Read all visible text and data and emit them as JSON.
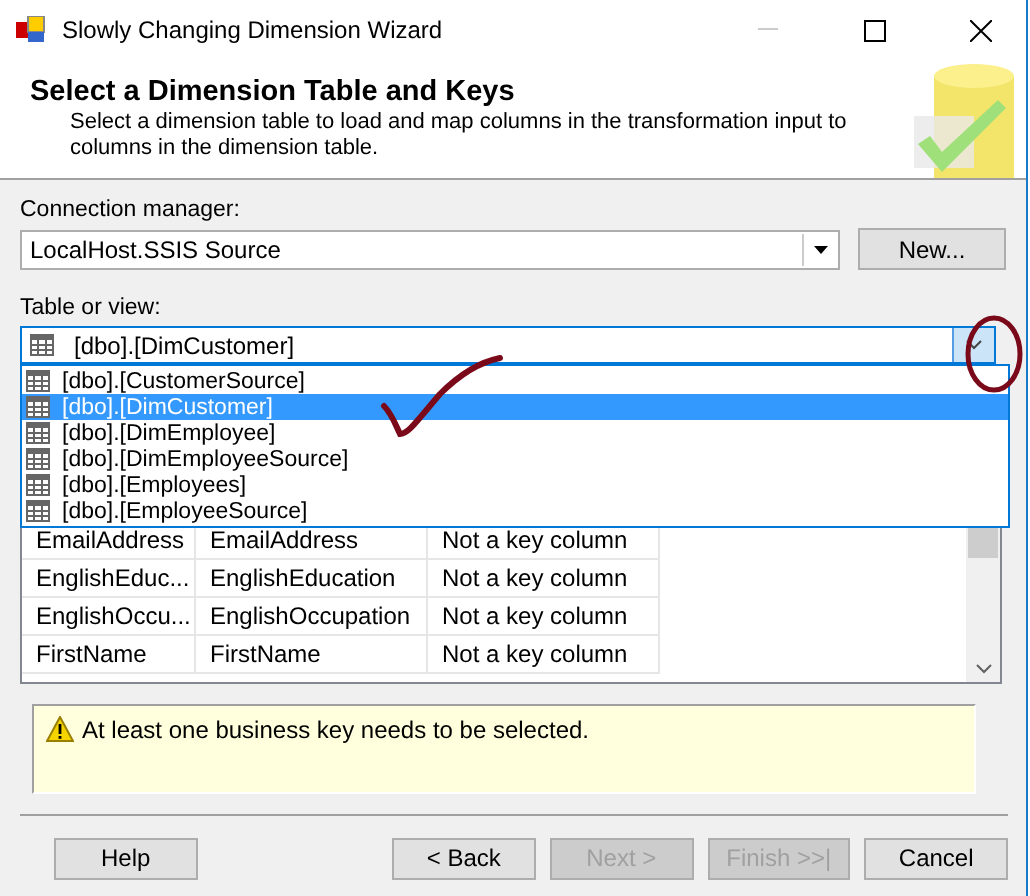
{
  "window": {
    "title": "Slowly Changing Dimension Wizard"
  },
  "header": {
    "title": "Select a Dimension Table and Keys",
    "description": "Select a dimension table to load and map columns in the transformation input to columns in the dimension table."
  },
  "connection": {
    "label": "Connection manager:",
    "value": "LocalHost.SSIS Source",
    "button": "New..."
  },
  "table_or_view": {
    "label": "Table or view:",
    "value": "[dbo].[DimCustomer]",
    "expanded": true,
    "options": [
      {
        "label": "[dbo].[CustomerSource]",
        "selected": false
      },
      {
        "label": "[dbo].[DimCustomer]",
        "selected": true
      },
      {
        "label": "[dbo].[DimEmployee]",
        "selected": false
      },
      {
        "label": "[dbo].[DimEmployeeSource]",
        "selected": false
      },
      {
        "label": "[dbo].[Employees]",
        "selected": false
      },
      {
        "label": "[dbo].[EmployeeSource]",
        "selected": false
      }
    ]
  },
  "grid": {
    "rows": [
      [
        "EmailAddress",
        "EmailAddress",
        "Not a key column"
      ],
      [
        "EnglishEduc...",
        "EnglishEducation",
        "Not a key column"
      ],
      [
        "EnglishOccu...",
        "EnglishOccupation",
        "Not a key column"
      ],
      [
        "FirstName",
        "FirstName",
        "Not a key column"
      ]
    ]
  },
  "message": "At least one business key needs to be selected.",
  "buttons": [
    {
      "label": "Help",
      "disabled": false
    },
    {
      "label": "< Back",
      "disabled": false
    },
    {
      "label": "Next >",
      "disabled": true
    },
    {
      "label": "Finish >>|",
      "disabled": true
    },
    {
      "label": "Cancel",
      "disabled": false
    }
  ]
}
